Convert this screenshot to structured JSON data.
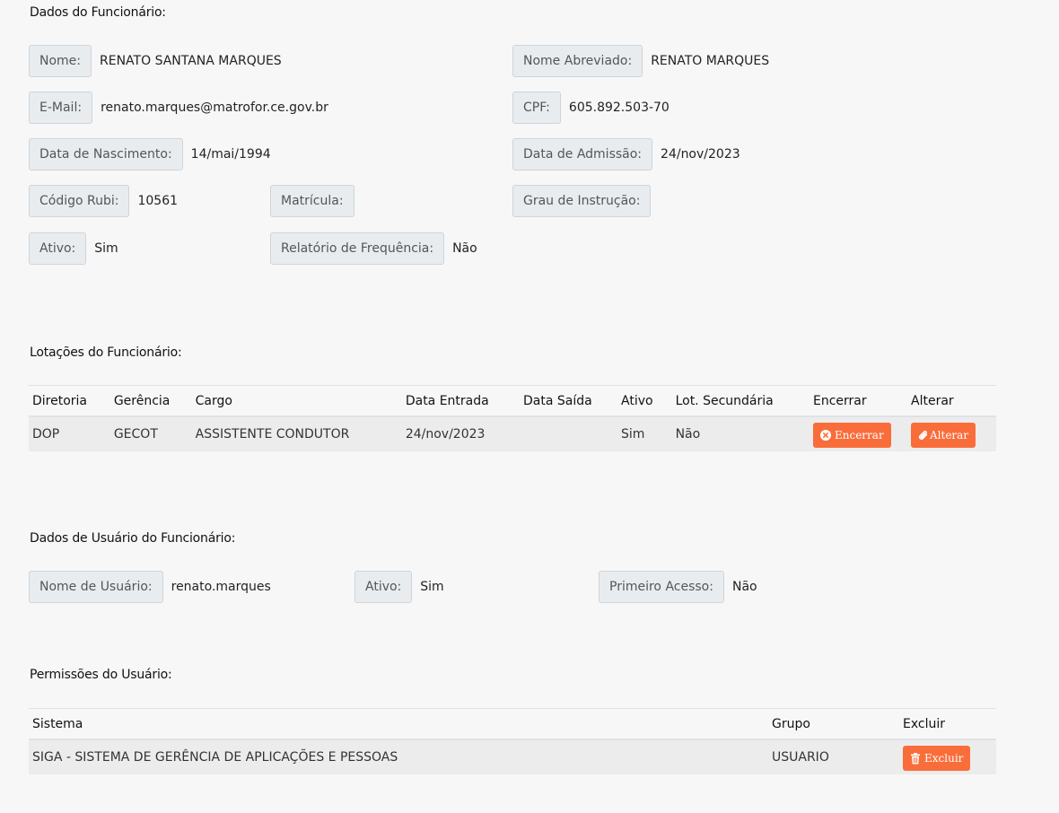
{
  "employee": {
    "title": "Dados do Funcionário:",
    "nome_label": "Nome:",
    "nome": "RENATO SANTANA MARQUES",
    "abrev_label": "Nome Abreviado:",
    "abrev": "RENATO MARQUES",
    "email_label": "E-Mail:",
    "email": "renato.marques@matrofor.ce.gov.br",
    "cpf_label": "CPF:",
    "cpf": "605.892.503-70",
    "nasc_label": "Data de Nascimento:",
    "nasc": "14/mai/1994",
    "admissao_label": "Data de Admissão:",
    "admissao": "24/nov/2023",
    "rubi_label": "Código Rubi:",
    "rubi": "10561",
    "matricula_label": "Matrícula:",
    "matricula": "",
    "grau_label": "Grau de Instrução:",
    "grau": "",
    "ativo_label": "Ativo:",
    "ativo": "Sim",
    "relatorio_label": "Relatório de Frequência:",
    "relatorio": "Não"
  },
  "lotacoes": {
    "title": "Lotações do Funcionário:",
    "headers": [
      "Diretoria",
      "Gerência",
      "Cargo",
      "Data Entrada",
      "Data Saída",
      "Ativo",
      "Lot. Secundária",
      "Encerrar",
      "Alterar"
    ],
    "rows": [
      {
        "diretoria": "DOP",
        "gerencia": "GECOT",
        "cargo": "ASSISTENTE CONDUTOR",
        "data_entrada": "24/nov/2023",
        "data_saida": "",
        "ativo": "Sim",
        "lot_secundaria": "Não",
        "encerrar_label": "Encerrar",
        "alterar_label": "Alterar"
      }
    ]
  },
  "usuario": {
    "title": "Dados de Usuário do Funcionário:",
    "nome_label": "Nome de Usuário:",
    "nome": "renato.marques",
    "ativo_label": "Ativo:",
    "ativo": "Sim",
    "primeiro_label": "Primeiro Acesso:",
    "primeiro": "Não"
  },
  "permissoes": {
    "title": "Permissões do Usuário:",
    "headers": [
      "Sistema",
      "Grupo",
      "Excluir"
    ],
    "rows": [
      {
        "sistema": "SIGA - SISTEMA DE GERÊNCIA DE APLICAÇÕES E PESSOAS",
        "grupo": "USUARIO",
        "excluir_label": "Excluir"
      }
    ]
  },
  "colors": {
    "accent": "#f96d3a",
    "label_bg": "#e9ecef",
    "row_bg": "#ececec"
  }
}
